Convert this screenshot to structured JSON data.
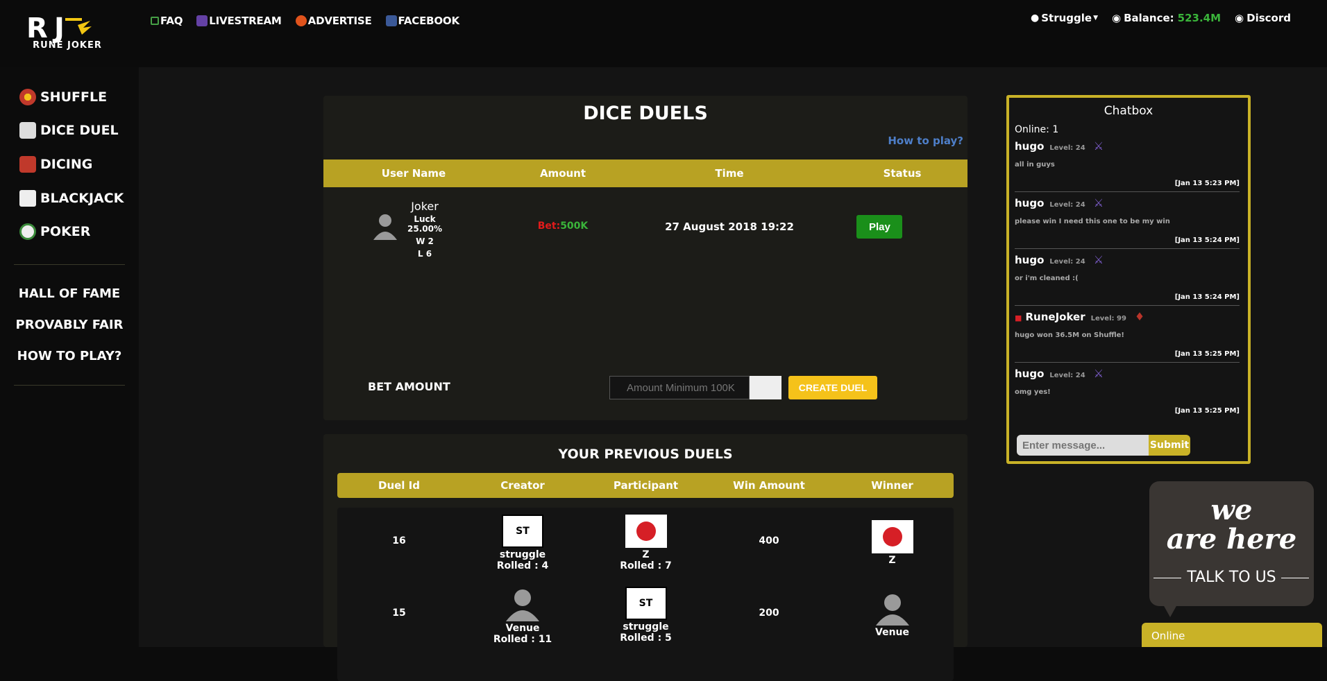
{
  "brand": {
    "name": "RUNE JOKER"
  },
  "topnav": {
    "faq": "FAQ",
    "livestream": "LIVESTREAM",
    "advertise": "ADVERTISE",
    "facebook": "FACEBOOK"
  },
  "userbar": {
    "username": "Struggle",
    "balance_label": "Balance:",
    "balance_value": "523.4M",
    "discord": "Discord"
  },
  "sidebar": {
    "games": [
      "SHUFFLE",
      "DICE DUEL",
      "DICING",
      "BLACKJACK",
      "POKER"
    ],
    "links": [
      "HALL OF FAME",
      "PROVABLY FAIR",
      "HOW TO PLAY?"
    ]
  },
  "dice": {
    "title": "DICE DUELS",
    "how_to_play": "How to play?",
    "columns": [
      "User Name",
      "Amount",
      "Time",
      "Status"
    ],
    "duel": {
      "name": "Joker",
      "luck": "Luck 25.00%",
      "wins": "W 2",
      "losses": "L 6",
      "bet_label": "Bet:",
      "bet_value": "500K",
      "time": "27 August 2018 19:22",
      "status_button": "Play"
    },
    "bet_amount_label": "BET AMOUNT",
    "amount_placeholder": "Amount Minimum 100K",
    "create_button": "CREATE DUEL"
  },
  "previous": {
    "title": "YOUR PREVIOUS DUELS",
    "columns": [
      "Duel Id",
      "Creator",
      "Participant",
      "Win Amount",
      "Winner"
    ],
    "rows": [
      {
        "id": "16",
        "creator": "struggle",
        "creator_roll": "Rolled : 4",
        "participant": "Z",
        "participant_roll": "Rolled : 7",
        "win": "400",
        "winner": "Z"
      },
      {
        "id": "15",
        "creator": "Venue",
        "creator_roll": "Rolled : 11",
        "participant": "struggle",
        "participant_roll": "Rolled : 5",
        "win": "200",
        "winner": "Venue"
      }
    ]
  },
  "chat": {
    "title": "Chatbox",
    "online": "Online: 1",
    "messages": [
      {
        "name": "hugo",
        "level": "Level: 24",
        "text": "all in guys",
        "time": "[Jan 13 5:23 PM]"
      },
      {
        "name": "hugo",
        "level": "Level: 24",
        "text": "please win I need this one to be my win",
        "time": "[Jan 13 5:24 PM]"
      },
      {
        "name": "hugo",
        "level": "Level: 24",
        "text": "or i'm cleaned :(",
        "time": "[Jan 13 5:24 PM]"
      },
      {
        "name": "RuneJoker",
        "level": "Level: 99",
        "text": "hugo won 36.5M on Shuffle!",
        "time": "[Jan 13 5:25 PM]"
      },
      {
        "name": "hugo",
        "level": "Level: 24",
        "text": "omg yes!",
        "time": "[Jan 13 5:25 PM]"
      }
    ],
    "input_placeholder": "Enter message...",
    "submit": "Submit"
  },
  "livechat": {
    "line1": "we",
    "line2": "are here",
    "line3": "TALK TO US",
    "online_tab": "Online"
  },
  "colors": {
    "gold": "#b8a223",
    "green": "#3ab43a",
    "red": "#e21b1b",
    "yellow": "#f5c21a"
  }
}
